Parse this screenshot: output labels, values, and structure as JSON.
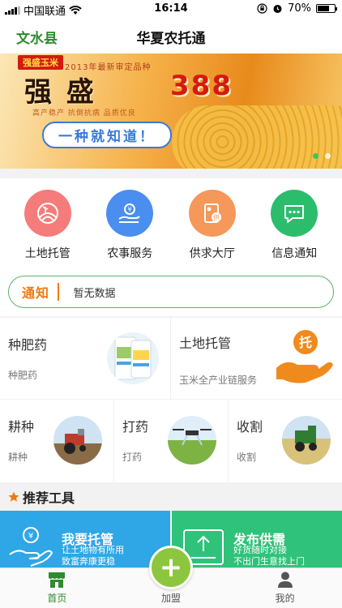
{
  "status_bar": {
    "carrier": "中国联通",
    "time": "16:14",
    "battery": "70%",
    "battery_level": 0.7
  },
  "navbar": {
    "county": "文水县",
    "title": "华夏农托通"
  },
  "banner": {
    "brand": "强盛玉米",
    "subtitle": "2013年最新审定品种",
    "headline_left": "强 盛",
    "headline_right": "388",
    "features": "高产稳产  抗倒抗病  品质优良",
    "slogan": "一种就知道！",
    "slide_count": 2,
    "active_slide": 1
  },
  "quick_menu": [
    {
      "label": "土地托管",
      "icon": "field-icon",
      "color": "#f57c7a"
    },
    {
      "label": "农事服务",
      "icon": "service-hand-icon",
      "color": "#4a8ef0"
    },
    {
      "label": "供求大厅",
      "icon": "supply-icon",
      "color": "#f5985a"
    },
    {
      "label": "信息通知",
      "icon": "message-icon",
      "color": "#2bbd6b"
    }
  ],
  "notice": {
    "tag": "通知",
    "text": "暂无数据"
  },
  "cards_top": [
    {
      "title": "种肥药",
      "subtitle": "种肥药"
    },
    {
      "title": "土地托管",
      "subtitle": "玉米全产业链服务",
      "badge": "托"
    }
  ],
  "cards_mid": [
    {
      "title": "耕种",
      "subtitle": "耕种"
    },
    {
      "title": "打药",
      "subtitle": "打药"
    },
    {
      "title": "收割",
      "subtitle": "收割"
    }
  ],
  "section": {
    "title": "推荐工具"
  },
  "tools": [
    {
      "title": "我要托管",
      "line1": "让土地物有所用",
      "line2": "致富奔康更稳"
    },
    {
      "title": "发布供需",
      "line1": "好货随时对接",
      "line2": "不出门生意找上门"
    }
  ],
  "tabbar": {
    "tabs": [
      {
        "label": "首页",
        "active": true
      },
      {
        "label": "加盟",
        "active": false
      },
      {
        "label": "我的",
        "active": false
      }
    ],
    "plus": "+"
  },
  "colors": {
    "accent_green": "#2e8b2e",
    "notice_orange": "#f07a12",
    "tool_blue": "#2fa7e6",
    "tool_green": "#2fc27a"
  }
}
